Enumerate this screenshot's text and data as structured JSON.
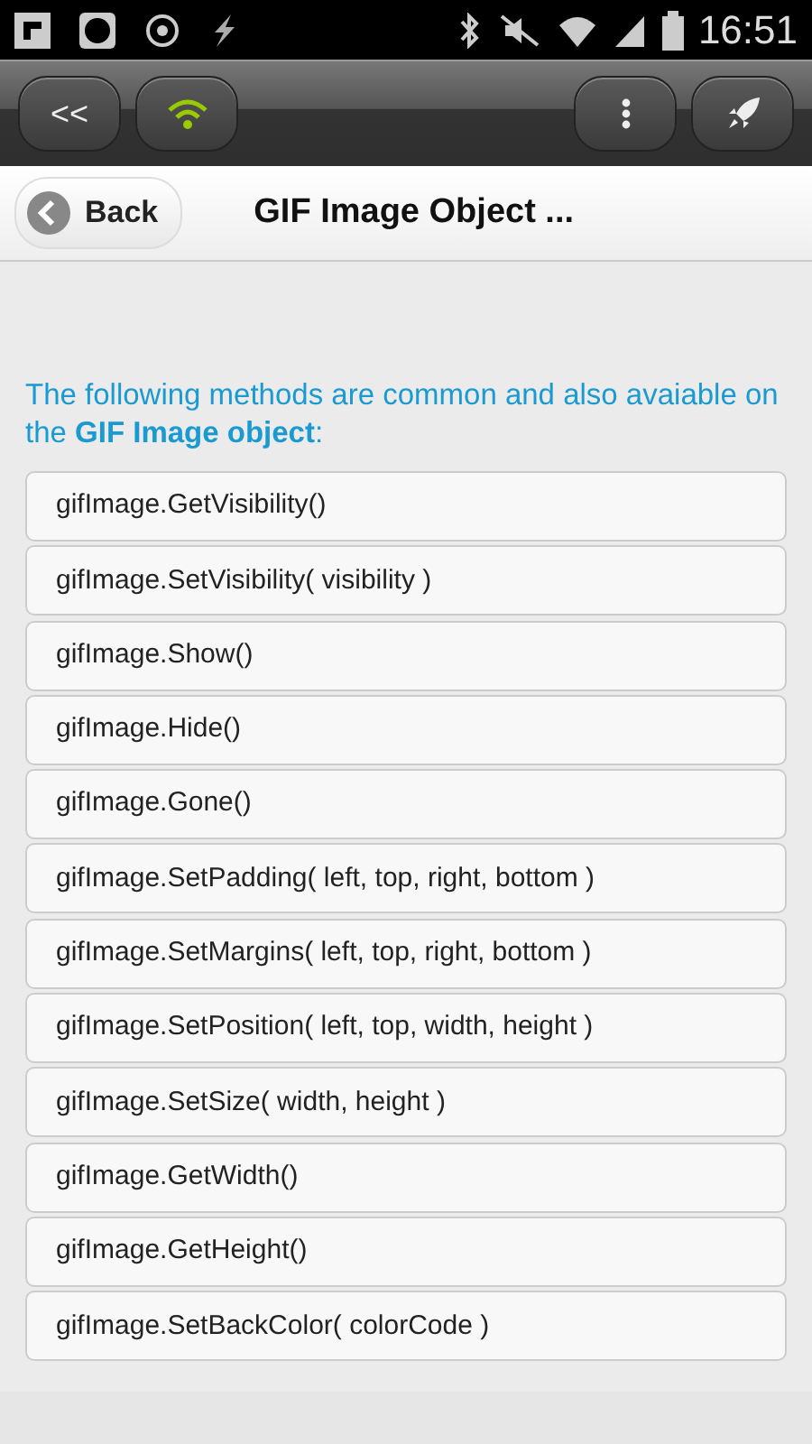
{
  "status_bar": {
    "time": "16:51"
  },
  "toolbar": {
    "buttons": [
      {
        "kind": "text",
        "label": "<<"
      },
      {
        "kind": "wifi"
      },
      {
        "kind": "menu"
      },
      {
        "kind": "rocket"
      }
    ]
  },
  "header": {
    "back": "Back",
    "title": "GIF Image Object ..."
  },
  "intro": "The following methods are common and also avaiable on the **GIF Image object**:",
  "methods": [
    "gifImage.GetVisibility()",
    "gifImage.SetVisibility( visibility )",
    "gifImage.Show()",
    "gifImage.Hide()",
    "gifImage.Gone()",
    "gifImage.SetPadding( left, top, right, bottom )",
    "gifImage.SetMargins( left, top, right, bottom )",
    "gifImage.SetPosition( left, top, width, height )",
    "gifImage.SetSize( width, height )",
    "gifImage.GetWidth()",
    "gifImage.GetHeight()",
    "gifImage.SetBackColor( colorCode )"
  ]
}
